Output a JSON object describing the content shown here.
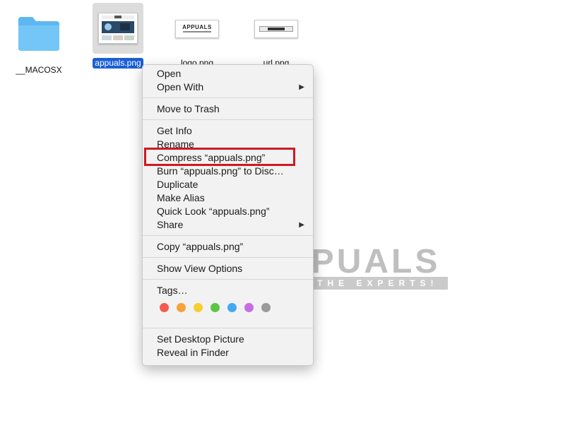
{
  "desktop": {
    "files": [
      {
        "name": "__MACOSX",
        "kind": "folder"
      },
      {
        "name": "appuals.png",
        "kind": "image",
        "selected": true
      },
      {
        "name": "logo.png",
        "kind": "image"
      },
      {
        "name": "url.png",
        "kind": "image"
      }
    ],
    "logo_thumb_text": "APPUALS"
  },
  "context_menu": {
    "open": "Open",
    "open_with": "Open With",
    "move_to_trash": "Move to Trash",
    "get_info": "Get Info",
    "rename": "Rename",
    "compress": "Compress “appuals.png”",
    "burn": "Burn “appuals.png” to Disc…",
    "duplicate": "Duplicate",
    "make_alias": "Make Alias",
    "quick_look": "Quick Look “appuals.png”",
    "share": "Share",
    "copy": "Copy “appuals.png”",
    "show_view_options": "Show View Options",
    "tags": "Tags…",
    "tag_colors": [
      "#f55a52",
      "#f7a23a",
      "#f4cf30",
      "#5dc744",
      "#44a8f2",
      "#c66ee0",
      "#9a9a9a"
    ],
    "set_desktop_picture": "Set Desktop Picture",
    "reveal_in_finder": "Reveal in Finder",
    "highlight_color": "#d0191f",
    "highlighted_item": "compress"
  },
  "watermark": {
    "brand": "APPUALS",
    "tagline": "FROM THE EXPERTS!"
  }
}
